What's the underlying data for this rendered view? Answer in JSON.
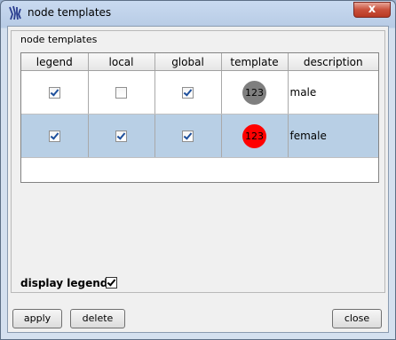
{
  "window": {
    "title": "node templates",
    "close_label": "x"
  },
  "group": {
    "label": "node templates"
  },
  "table": {
    "columns": [
      "legend",
      "local",
      "global",
      "template",
      "description"
    ],
    "rows": [
      {
        "legend": true,
        "local": false,
        "global": true,
        "template_text": "123",
        "template_color": "#7f7f7f",
        "description": "male",
        "selected": false
      },
      {
        "legend": true,
        "local": true,
        "global": true,
        "template_text": "123",
        "template_color": "#ff0000",
        "description": "female",
        "selected": true
      }
    ]
  },
  "display_legend": {
    "label": "display legend",
    "checked": true
  },
  "buttons": {
    "apply": "apply",
    "delete": "delete",
    "close": "close"
  },
  "colors": {
    "selection": "#b8cfe5",
    "titlebar": "#c9daf0",
    "close_button": "#c9503b"
  }
}
